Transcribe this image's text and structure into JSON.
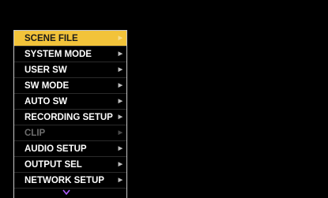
{
  "menu": {
    "items": [
      {
        "label": "SCENE FILE",
        "selected": true,
        "enabled": true
      },
      {
        "label": "SYSTEM MODE",
        "selected": false,
        "enabled": true
      },
      {
        "label": "USER SW",
        "selected": false,
        "enabled": true
      },
      {
        "label": "SW MODE",
        "selected": false,
        "enabled": true
      },
      {
        "label": "AUTO SW",
        "selected": false,
        "enabled": true
      },
      {
        "label": "RECORDING SETUP",
        "selected": false,
        "enabled": true
      },
      {
        "label": "CLIP",
        "selected": false,
        "enabled": false
      },
      {
        "label": "AUDIO SETUP",
        "selected": false,
        "enabled": true
      },
      {
        "label": "OUTPUT SEL",
        "selected": false,
        "enabled": true
      },
      {
        "label": "NETWORK SETUP",
        "selected": false,
        "enabled": true
      }
    ],
    "submenu_icon": "chevron-right-icon",
    "more_icon": "chevron-down-icon"
  },
  "colors": {
    "background": "#000000",
    "selected_bg": "#f2c33a",
    "text": "#ffffff",
    "disabled_text": "#6e6e6e",
    "more_indicator": "#b05cff"
  }
}
